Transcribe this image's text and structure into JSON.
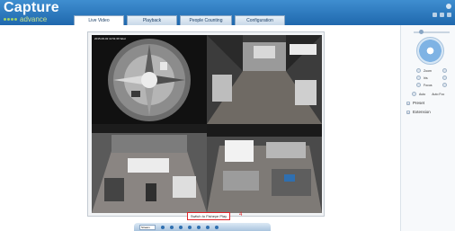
{
  "brand": {
    "name": "Capture",
    "tagline": "advance"
  },
  "tabs": [
    {
      "label": "Live Video",
      "active": true
    },
    {
      "label": "Playback",
      "active": false
    },
    {
      "label": "People Counting",
      "active": false
    },
    {
      "label": "Configuration",
      "active": false
    }
  ],
  "video": {
    "overlay_text": "2015-06-02 11:51:36 Wed",
    "split_button_label": "Switch to Fisheye Play",
    "annotation_number": "4"
  },
  "bottom_toolbar": {
    "stream_value": "Stream"
  },
  "ptz": {
    "zoom_label": "Zoom",
    "iris_label": "Iris",
    "focus_label": "Focus",
    "auto_label": "Auto",
    "auto_focus_label": "Auto Foc",
    "preset_label": "Preset",
    "extension_label": "Extension"
  },
  "colors": {
    "header_blue": "#1f68ad",
    "accent_green": "#9fd16a",
    "annotation_red": "#e0262b"
  }
}
